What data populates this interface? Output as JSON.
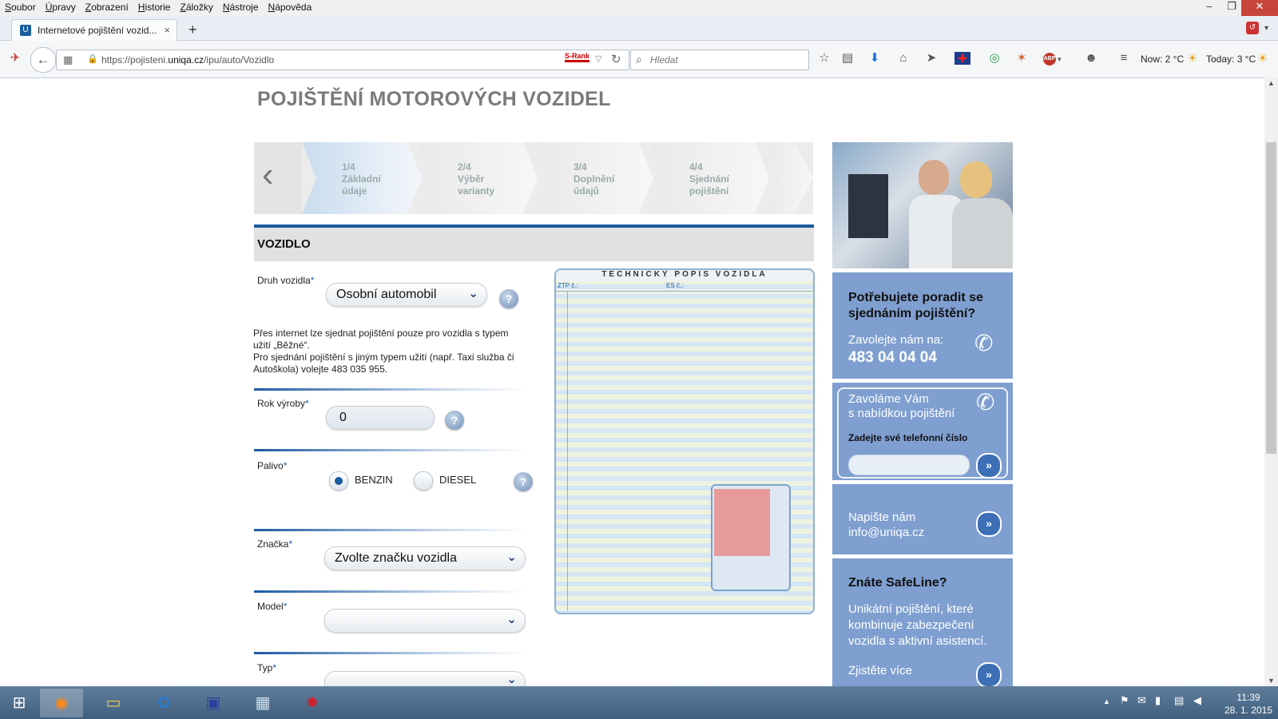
{
  "menubar": {
    "items": [
      "Soubor",
      "Úpravy",
      "Zobrazení",
      "Historie",
      "Záložky",
      "Nástroje",
      "Nápověda"
    ]
  },
  "window": {
    "minimize": "–",
    "restore": "❐",
    "close": "✕"
  },
  "tab": {
    "title": "Internetové pojištění vozid...",
    "close": "×",
    "new": "+"
  },
  "nav": {
    "url_prefix": "https://pojisteni.",
    "url_domain": "uniqa.cz",
    "url_path": "/ipu/auto/Vozidlo",
    "srank": "S-Rank",
    "search_placeholder": "Hledat",
    "weather_now": "Now: 2 °C",
    "weather_today": "Today: 3 °C"
  },
  "page": {
    "title": "POJIŠTĚNÍ MOTOROVÝCH VOZIDEL",
    "steps": [
      {
        "num": "1/4",
        "l1": "Základní",
        "l2": "údaje"
      },
      {
        "num": "2/4",
        "l1": "Výběr",
        "l2": "varianty"
      },
      {
        "num": "3/4",
        "l1": "Doplnění",
        "l2": "údajů"
      },
      {
        "num": "4/4",
        "l1": "Sjednání",
        "l2": "pojištění"
      }
    ],
    "section_title": "VOZIDLO",
    "form": {
      "druh_label": "Druh vozidla",
      "druh_value": "Osobní automobil",
      "info_line1": "Přes internet lze sjednat pojištění pouze pro vozidla s typem",
      "info_line2": "užití „Běžné“.",
      "info_line3": "Pro sjednání pojištění s jiným typem užití (např. Taxi služba či",
      "info_line4": "Autoškola) volejte 483 035 955.",
      "rok_label": "Rok výroby",
      "rok_value": "0",
      "palivo_label": "Palivo",
      "palivo_opt1": "BENZIN",
      "palivo_opt2": "DIESEL",
      "znacka_label": "Značka",
      "znacka_value": "Zvolte značku vozidla",
      "model_label": "Model",
      "typ_label": "Typ",
      "required_mark": "*",
      "help": "?"
    },
    "techdoc": {
      "title": "TECHNICKÝ POPIS VOZIDLA",
      "ztp": "ZTP č.:",
      "es": "ES č.:"
    }
  },
  "sidebar": {
    "help_title_l1": "Potřebujete poradit se",
    "help_title_l2": "sjednáním pojištění?",
    "call_label": "Zavolejte nám na:",
    "phone": "483 04 04 04",
    "callback_l1": "Zavoláme Vám",
    "callback_l2": "s nabídkou pojištění",
    "callback_prompt": "Zadejte své telefonní číslo",
    "write_l1": "Napište nám",
    "email": "info@uniqa.cz",
    "safeline_title": "Znáte SafeLine?",
    "safeline_l1": "Unikátní pojištění, které",
    "safeline_l2": "kombinuje zabezpečení",
    "safeline_l3": "vozidla s aktivní asistencí.",
    "more": "Zjistěte více"
  },
  "taskbar": {
    "time": "11:39",
    "date": "28. 1. 2015"
  }
}
